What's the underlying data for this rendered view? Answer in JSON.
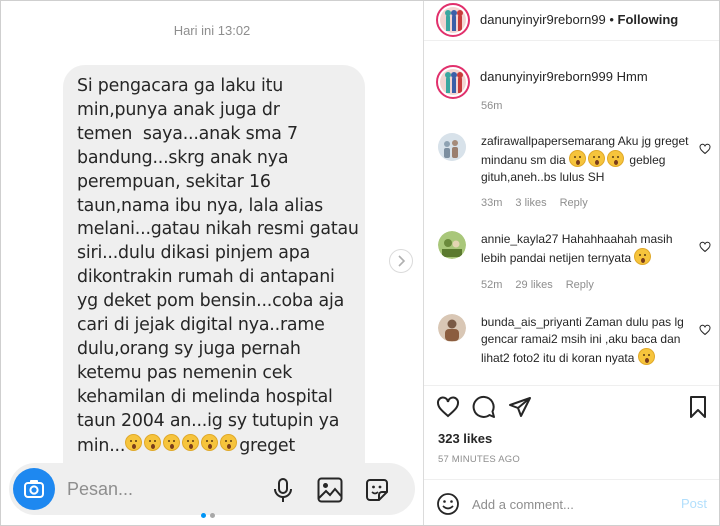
{
  "chat": {
    "timestamp": "Hari ini 13:02",
    "message_lines": [
      "Si pengacara ga laku itu",
      "min,punya anak juga dr",
      "temen  saya...anak sma 7",
      "bandung...skrg anak nya",
      "perempuan, sekitar 16",
      "taun,nama ibu nya, lala alias",
      "melani...gatau nikah resmi gatau",
      "siri...dulu dikasi pinjem apa",
      "dikontrakin rumah di antapani",
      "yg deket pom bensin...coba aja",
      "cari di jejak digital nya..rame",
      "dulu,orang sy juga pernah",
      "ketemu pas nemenin cek",
      "kehamilan di melinda hospital",
      "taun 2004 an...ig sy tutupin ya",
      "min...",
      "greget"
    ],
    "composer_placeholder": "Pesan..."
  },
  "post": {
    "header_username": "danunyinyir9reborn99",
    "header_separator": " • ",
    "follow_label": "Following",
    "caption_username": "danunyinyir9reborn999",
    "caption_text": "Hmm",
    "caption_time": "56m",
    "comments": [
      {
        "username": "zafirawallpapersemarang",
        "text": "Aku jg greget mindanu sm dia",
        "text2": "gebleg gituh,aneh..bs lulus SH",
        "time": "33m",
        "likes": "3 likes",
        "reply": "Reply"
      },
      {
        "username": "annie_kayla27",
        "text": "Hahahhaahah masih lebih pandai netijen ternyata",
        "time": "52m",
        "likes": "29 likes",
        "reply": "Reply"
      },
      {
        "username": "bunda_ais_priyanti",
        "text": "Zaman dulu pas lg gencar ramai2 msih ini ,aku baca dan lihat2 foto2 itu di koran nyata"
      }
    ],
    "likes_count": "323 likes",
    "post_date": "57 MINUTES AGO",
    "add_comment_placeholder": "Add a comment...",
    "post_button": "Post"
  },
  "colors": {
    "accent_blue": "#1e88f0",
    "post_button_disabled": "#b2dffc",
    "bubble_gray": "#efefef",
    "story_ring": "#e1306c"
  }
}
